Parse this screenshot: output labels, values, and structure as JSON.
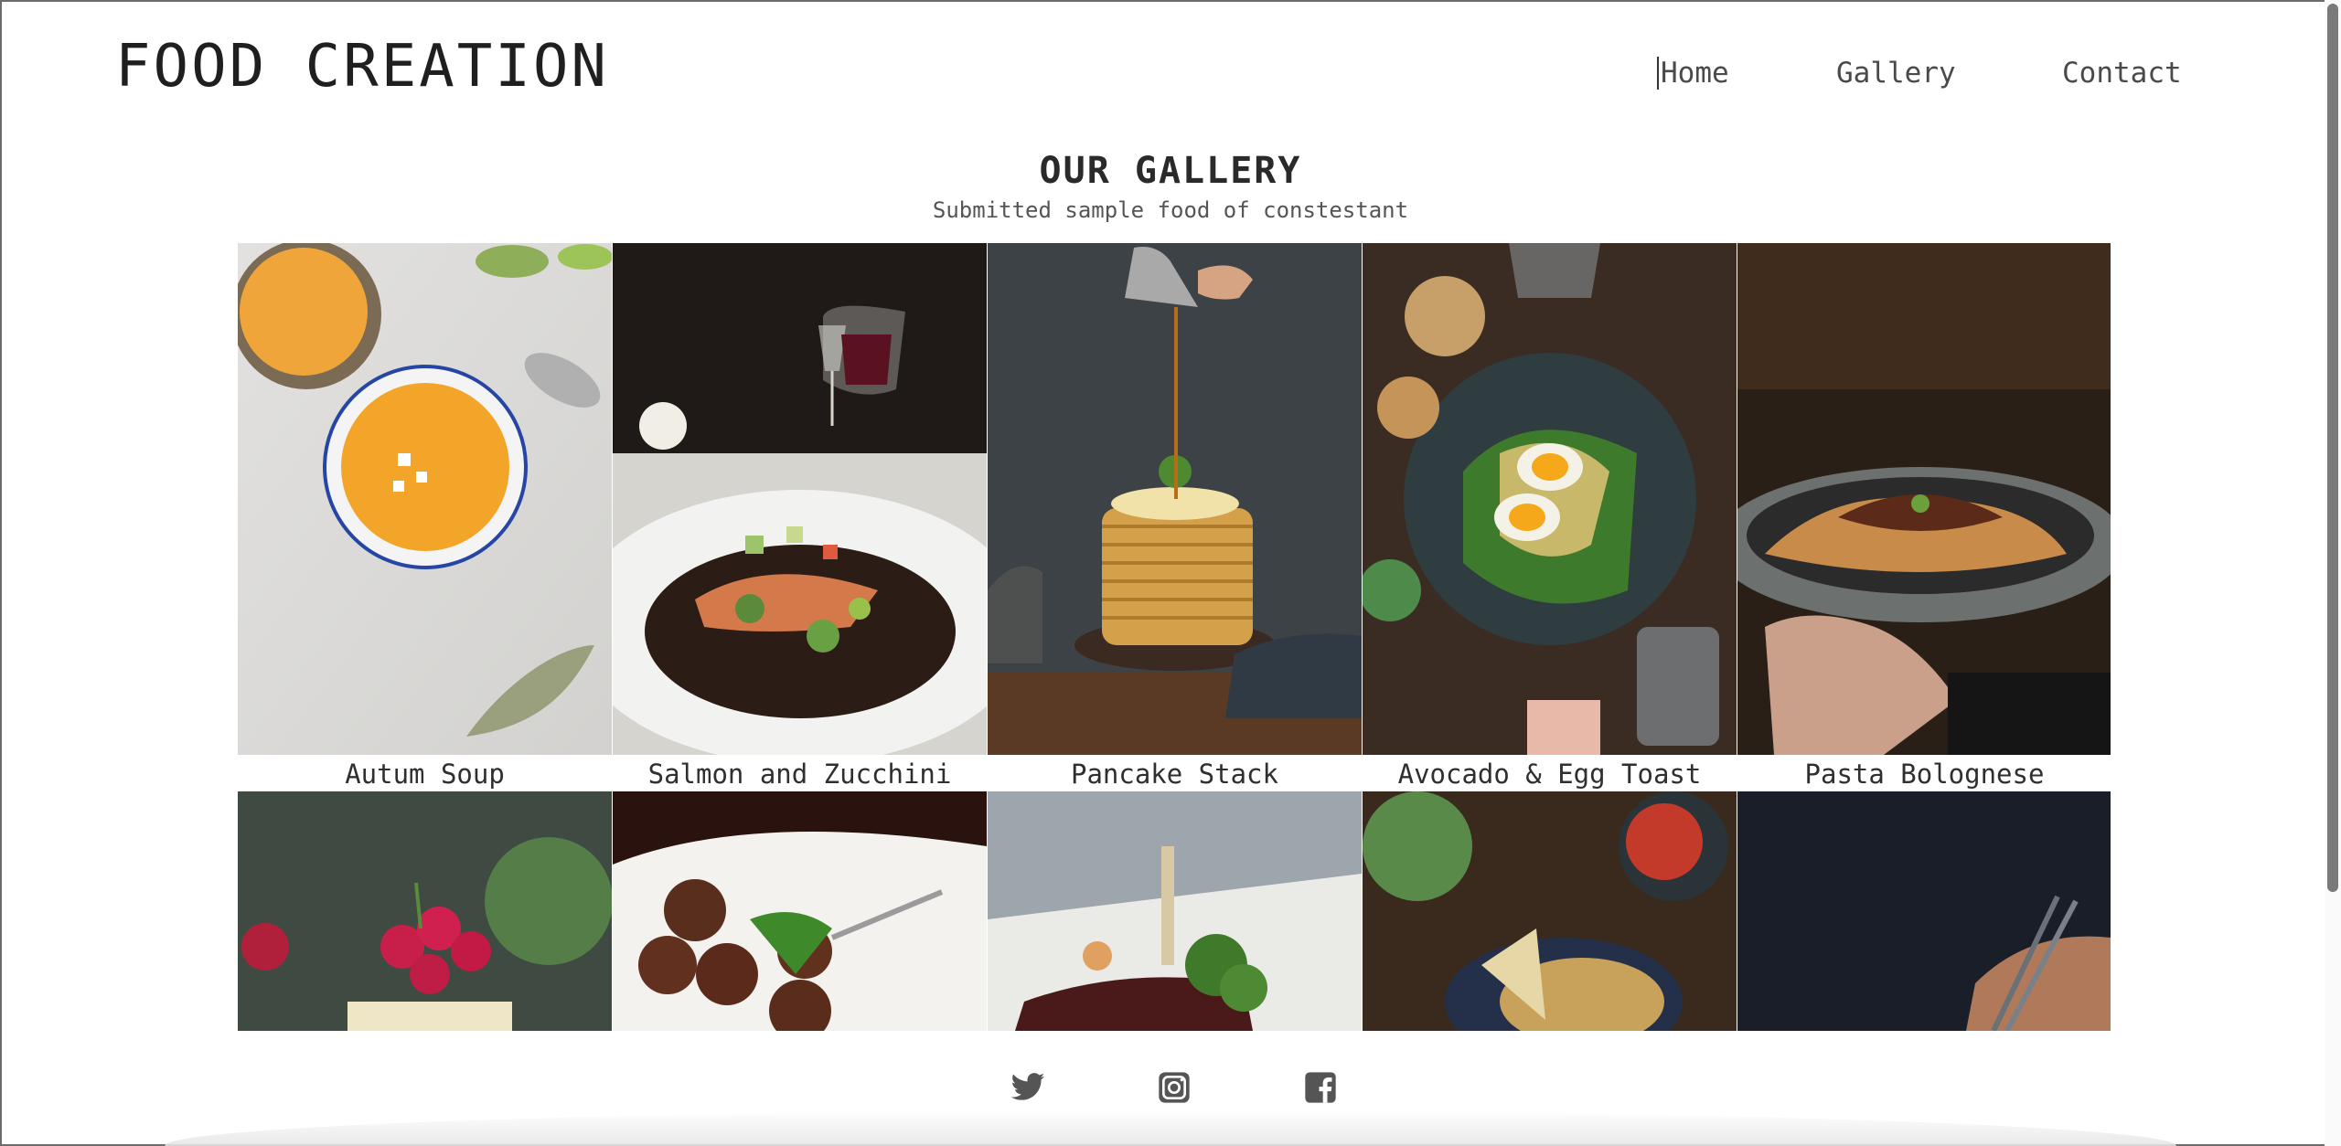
{
  "header": {
    "logo": "FOOD CREATION",
    "nav": [
      {
        "label": "Home"
      },
      {
        "label": "Gallery"
      },
      {
        "label": "Contact"
      }
    ]
  },
  "gallery": {
    "title": "OUR GALLERY",
    "subtitle": "Submitted sample food of constestant",
    "items": [
      {
        "caption": "Autum Soup"
      },
      {
        "caption": "Salmon and Zucchini"
      },
      {
        "caption": "Pancake Stack"
      },
      {
        "caption": "Avocado & Egg Toast"
      },
      {
        "caption": "Pasta Bolognese"
      }
    ]
  },
  "footer": {
    "icons": [
      "twitter-icon",
      "instagram-icon",
      "facebook-icon"
    ]
  },
  "colors": {
    "icon": "#555555",
    "text": "#2a2a2a"
  }
}
